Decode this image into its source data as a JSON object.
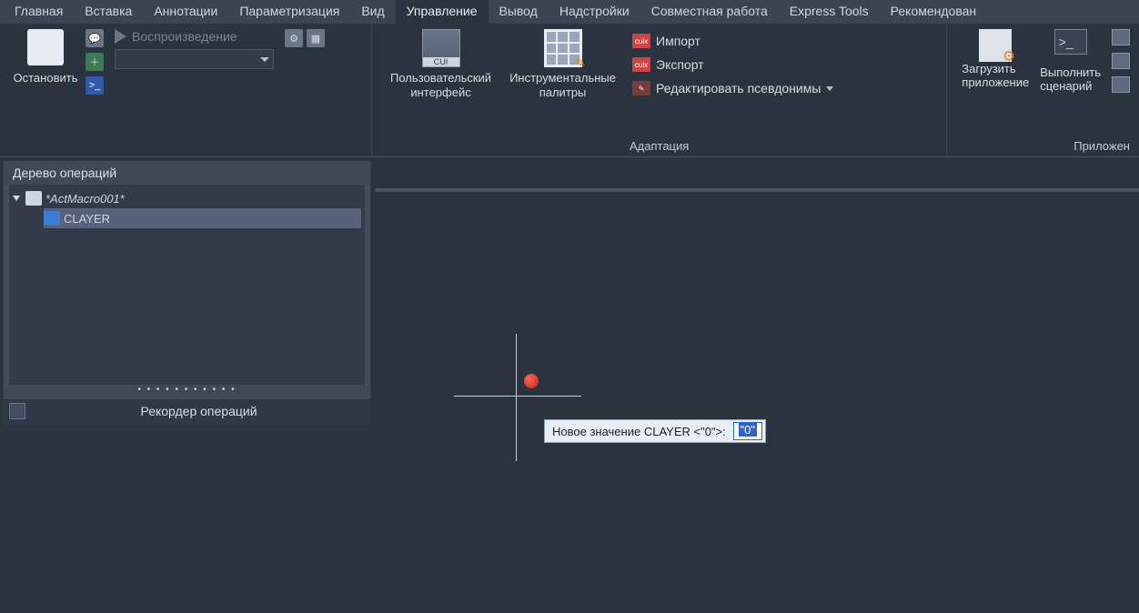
{
  "menu": {
    "items": [
      "Главная",
      "Вставка",
      "Аннотации",
      "Параметризация",
      "Вид",
      "Управление",
      "Вывод",
      "Надстройки",
      "Совместная работа",
      "Express Tools",
      "Рекомендован"
    ],
    "active_index": 5
  },
  "ribbon": {
    "group_recorder": {
      "stop_label": "Остановить",
      "play_label": "Воспроизведение"
    },
    "group_adaptation": {
      "cui_label_line1": "Пользовательский",
      "cui_label_line2": "интерфейс",
      "palettes_label_line1": "Инструментальные",
      "palettes_label_line2": "палитры",
      "import_label": "Импорт",
      "export_label": "Экспорт",
      "aliases_label": "Редактировать псевдонимы",
      "group_label": "Адаптация"
    },
    "group_apps": {
      "load_label_line1": "Загрузить",
      "load_label_line2": "приложение",
      "script_label_line1": "Выполнить",
      "script_label_line2": "сценарий",
      "group_label": "Приложен"
    }
  },
  "panel": {
    "header": "Дерево операций",
    "macro_name": "*ActMacro001*",
    "child_cmd": "CLAYER",
    "footer": "Рекордер операций"
  },
  "prompt": {
    "text": "Новое значение CLAYER <\"0\">:",
    "value": "\"0\""
  }
}
